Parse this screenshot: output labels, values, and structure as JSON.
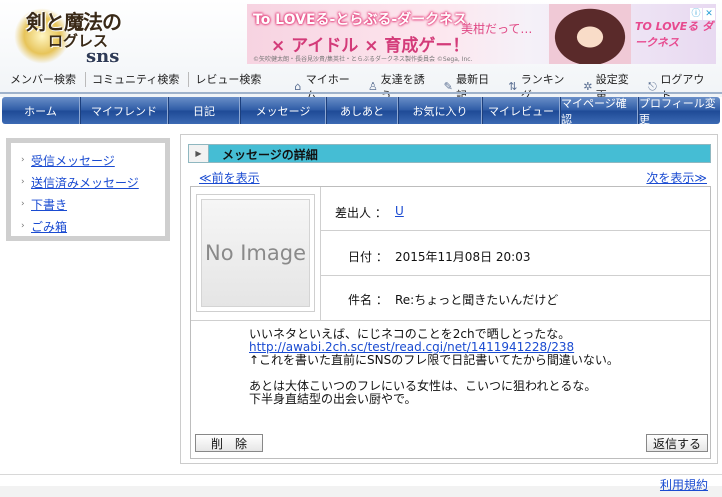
{
  "header": {
    "logo": {
      "line1": "剣と魔法の",
      "line2": "ログレス",
      "line3": "sns"
    },
    "ad": {
      "line1": "To LOVEる-とらぶる-ダークネス",
      "line2": "× アイドル × 育成ゲー！",
      "line3": "©矢吹健太朗・長谷見沙貴/集英社・とらぶるダークネス製作委員会 ©Sega, Inc.",
      "speech": "美柑だって…",
      "brand": "TO LOVEる ダークネス"
    },
    "search_links": [
      "メンバー検索",
      "コミュニティ検索",
      "レビュー検索"
    ],
    "top_links": [
      {
        "icon": "home-icon",
        "glyph": "⌂",
        "label": "マイホーム"
      },
      {
        "icon": "person-icon",
        "glyph": "♙",
        "label": "友達を誘う"
      },
      {
        "icon": "pencil-icon",
        "glyph": "✎",
        "label": "最新日記"
      },
      {
        "icon": "ranking-icon",
        "glyph": "⇅",
        "label": "ランキング"
      },
      {
        "icon": "gear-icon",
        "glyph": "✲",
        "label": "設定変更"
      },
      {
        "icon": "logout-icon",
        "glyph": "⎋",
        "label": "ログアウト"
      }
    ]
  },
  "nav": {
    "items": [
      "ホーム",
      "マイフレンド",
      "日記",
      "メッセージ",
      "あしあと",
      "お気に入り",
      "マイレビュー",
      "マイページ確認",
      "プロフィール変更"
    ]
  },
  "sidebar": {
    "items": [
      "受信メッセージ",
      "送信済みメッセージ",
      "下書き",
      "ごみ箱"
    ]
  },
  "message": {
    "title": "メッセージの詳細",
    "prev": "≪前を表示",
    "next": "次を表示≫",
    "photo_text": "No Image",
    "sender_label": "差出人 ：",
    "sender_name": "U",
    "date_label": "日付 ：",
    "date_value": "2015年11月08日 20:03",
    "subject_label": "件名 ：",
    "subject_value": "Re:ちょっと聞きたいんだけど",
    "body_line1": "いいネタといえば、にじネコのことを2chで晒しとったな。",
    "body_link": "http://awabi.2ch.sc/test/read.cgi/net/1411941228/238",
    "body_line3": "↑これを書いた直前にSNSのフレ限で日記書いてたから間違いない。",
    "body_line5": "あとは大体こいつのフレにいる女性は、こいつに狙われとるな。",
    "body_line6": "下半身直結型の出会い厨やで。",
    "delete_button": "削　除",
    "reply_button": "返信する"
  },
  "footer": {
    "terms": "利用規約"
  },
  "colors": {
    "nav": "#2d5aa5",
    "titlebar": "#45bdd4",
    "link": "#1a4bd1"
  }
}
